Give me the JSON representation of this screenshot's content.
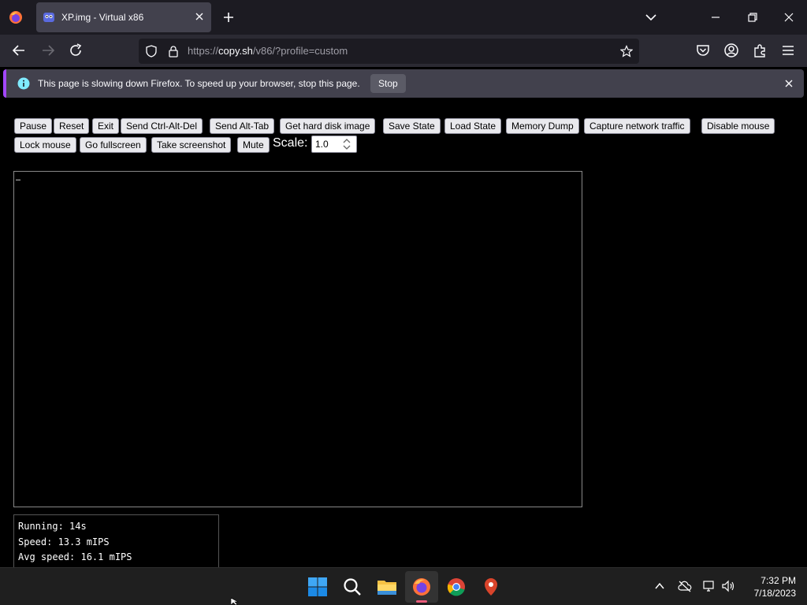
{
  "browser": {
    "tab": {
      "title": "XP.img - Virtual x86"
    },
    "url": {
      "prefix": "https://",
      "domain": "copy.sh",
      "path": "/v86/?profile=custom"
    }
  },
  "notice": {
    "text": "This page is slowing down Firefox. To speed up your browser, stop this page.",
    "stop_label": "Stop"
  },
  "toolbar": {
    "buttons": [
      "Pause",
      "Reset",
      "Exit",
      "Send Ctrl-Alt-Del",
      "Send Alt-Tab",
      "Get hard disk image",
      "Save State",
      "Load State",
      "Memory Dump",
      "Capture network traffic",
      "Disable mouse",
      "Lock mouse",
      "Go fullscreen",
      "Take screenshot",
      "Mute"
    ],
    "scale_label": "Scale:",
    "scale_value": "1.0"
  },
  "stats": {
    "running": "Running: 14s",
    "speed": "Speed: 13.3 mIPS",
    "avg_speed": "Avg speed: 16.1 mIPS"
  },
  "taskbar": {
    "time": "7:32 PM",
    "date": "7/18/2023"
  },
  "colors": {
    "accent": "#a347ff",
    "tab_bg": "#42414d",
    "taskbar": "#1f1f1f"
  }
}
